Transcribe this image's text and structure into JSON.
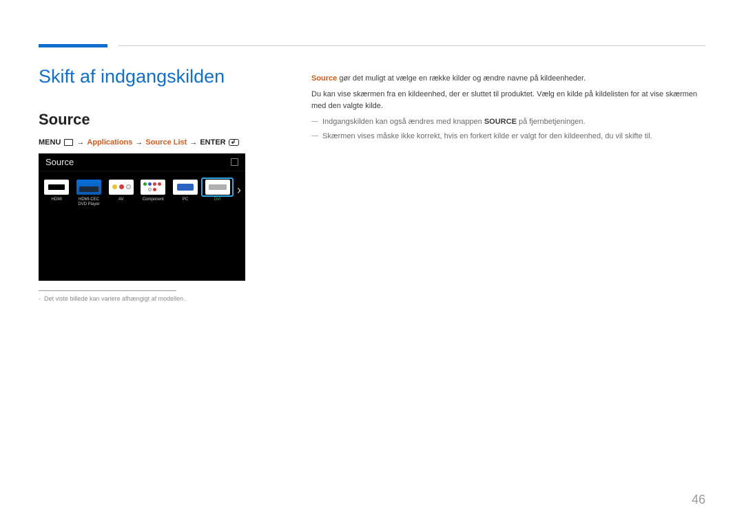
{
  "chapterTitle": "Skift af indgangskilden",
  "sectionTitle": "Source",
  "menuPath": {
    "menu": "MENU",
    "arrow": "→",
    "applications": "Applications",
    "sourceList": "Source List",
    "enter": "ENTER"
  },
  "sourceUi": {
    "header": "Source",
    "items": [
      {
        "label": "HDMI",
        "selected": false
      },
      {
        "label": "HDMI-CEC\nDVD Player",
        "selected": false
      },
      {
        "label": "AV",
        "selected": false
      },
      {
        "label": "Component",
        "selected": false
      },
      {
        "label": "PC",
        "selected": false
      },
      {
        "label": "DVI",
        "selected": true
      }
    ]
  },
  "footnote": "Det viste billede kan variere afhængigt af modellen.",
  "right": {
    "p1a": "Source",
    "p1b": " gør det muligt at vælge en række kilder og ændre navne på kildeenheder.",
    "p2": "Du kan vise skærmen fra en kildeenhed, der er sluttet til produktet. Vælg en kilde på kildelisten for at vise skærmen med den valgte kilde.",
    "n1a": "Indgangskilden kan også ændres med knappen ",
    "n1b": "SOURCE",
    "n1c": " på fjernbetjeningen.",
    "n2": "Skærmen vises måske ikke korrekt, hvis en forkert kilde er valgt for den kildeenhed, du vil skifte til."
  },
  "pageNumber": "46"
}
